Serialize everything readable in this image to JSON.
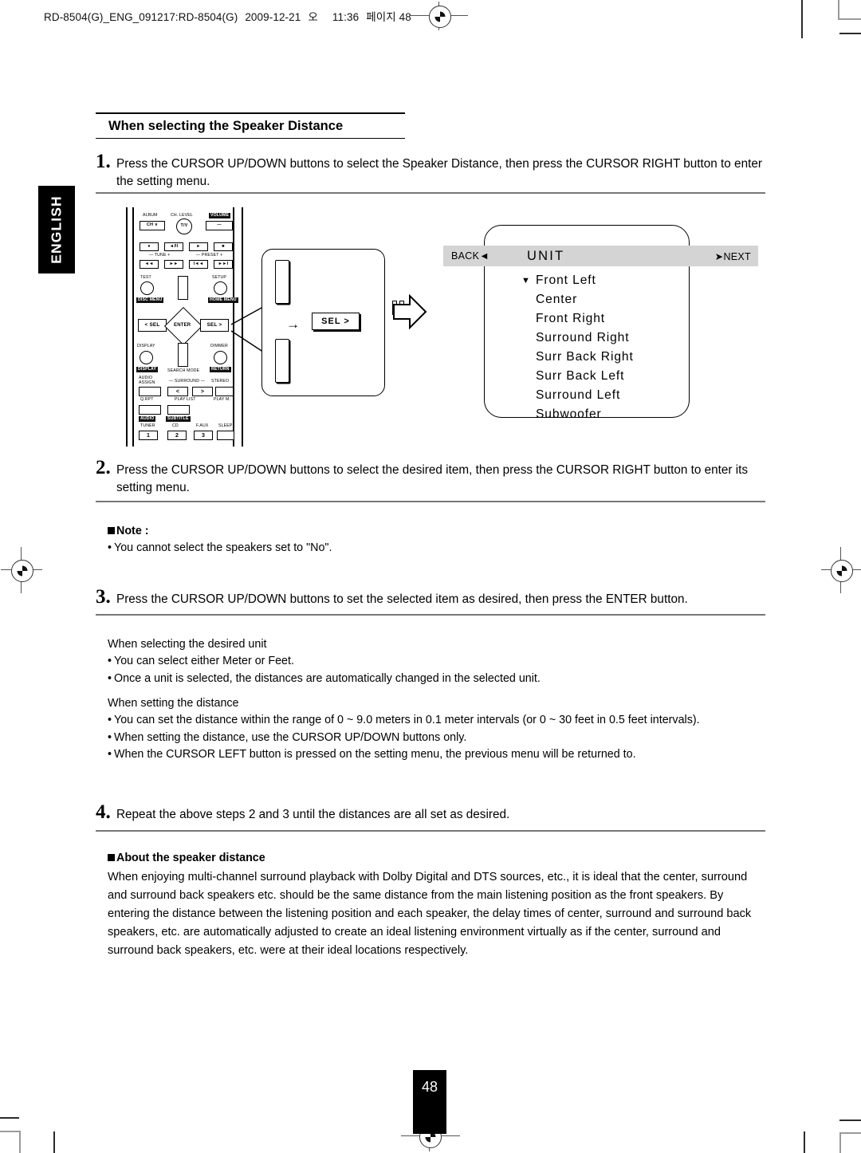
{
  "print_header": {
    "file": "RD-8504(G)_ENG_091217:RD-8504(G)",
    "date": "2009-12-21",
    "ampm": "오",
    "time": "11:36",
    "page_label": "페이지 48"
  },
  "side_tab": {
    "label": "ENGLISH"
  },
  "section": {
    "title": "When selecting the Speaker Distance"
  },
  "steps": [
    {
      "num": "1.",
      "text": "Press the CURSOR UP/DOWN buttons to select the Speaker Distance, then press the CURSOR RIGHT button to enter the setting menu."
    },
    {
      "num": "2.",
      "text": "Press the CURSOR UP/DOWN buttons to select the desired item, then press the CURSOR RIGHT button to enter its setting menu."
    },
    {
      "num": "3.",
      "text": "Press the CURSOR UP/DOWN buttons to set the selected item as desired, then press the ENTER button."
    },
    {
      "num": "4.",
      "text": "Repeat the above steps 2 and 3 until the distances are all set as desired."
    }
  ],
  "note": {
    "heading": "Note :",
    "bullets": [
      "You cannot select the speakers set to \"No\"."
    ]
  },
  "unit_block": {
    "heading": "When selecting the desired unit",
    "bullets": [
      "You can select either Meter or Feet.",
      "Once a unit is selected, the distances are automatically changed in the selected unit."
    ]
  },
  "distance_block": {
    "heading": "When setting the distance",
    "bullets": [
      "You can set the distance within the range of 0 ~ 9.0 meters in 0.1 meter intervals (or 0 ~ 30 feet in 0.5 feet intervals).",
      "When setting the distance, use the CURSOR UP/DOWN buttons only.",
      "When the CURSOR LEFT button is pressed on the setting menu, the previous menu will be returned to."
    ]
  },
  "about_block": {
    "heading": "About the speaker distance",
    "paragraph": "When enjoying multi-channel surround playback with Dolby Digital and DTS sources, etc., it is ideal that the center, surround and surround back speakers etc. should be the same distance from the main listening position as the front speakers. By entering the distance between the listening position and each speaker, the delay times of center, surround and surround back speakers, etc. are automatically adjusted to create an ideal listening environment virtually as if the center, surround and surround back speakers, etc. were at their ideal locations respectively."
  },
  "osd": {
    "back_label": "BACK",
    "back_arrow": "◄",
    "title": "UNIT",
    "next_arrow": "➤",
    "next_label": "NEXT",
    "caret": "▼",
    "items": [
      "Front Left",
      "Center",
      "Front Right",
      "Surround Right",
      "Surr Back Right",
      "Surr Back Left",
      "Surround Left",
      "Subwoofer"
    ]
  },
  "remote": {
    "labels": {
      "album": "ALBUM",
      "ch_level": "CH. LEVEL",
      "volume": "VOLUME",
      "ch_down": "CH ∨",
      "tv": "T/V",
      "vol_minus": "—",
      "tune": "— TUNE  +",
      "preset": "— PRESET +",
      "test": "TEST",
      "setup": "SETUP",
      "disc_menu": "DISC MENU",
      "home_menu": "HOME MENU",
      "sel_left": "< SEL",
      "enter": "ENTER",
      "sel_right": "SEL >",
      "display": "DISPLAY",
      "display_box": "DISPLAY",
      "dimmer": "DIMMER",
      "return_box": "RETURN",
      "search_mode": "SEARCH MODE",
      "audio_assign": "AUDIO\nASSIGN",
      "surround": "— SURROUND —",
      "stereo": "STEREO",
      "q_rpt": "Q.RPT",
      "play_list": "PLAY LIST",
      "play_m": "PLAY M.",
      "audio_box": "AUDIO",
      "subtitle_box": "SUBTITLE",
      "tuner": "TUNER",
      "cd": "CD",
      "f_aux": "F.AUX",
      "sleep": "SLEEP",
      "num1": "1",
      "num2": "2",
      "num3": "3",
      "rec": "●",
      "play_pause": "◄/II",
      "play": "►",
      "stop": "■",
      "rew": "◄◄",
      "ffwd": "►►",
      "prev": "I◄◄",
      "next": "►►I",
      "surr_left": "<",
      "surr_right": ">"
    }
  },
  "zoom_panel": {
    "sel_label": "SEL >",
    "arrow": "→"
  },
  "page_number": "48"
}
